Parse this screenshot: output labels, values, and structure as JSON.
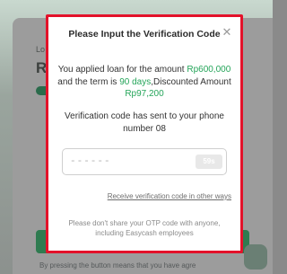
{
  "background": {
    "lo_text": "Lo",
    "r_text": "R",
    "footer_text": "By pressing the button means that you have agre"
  },
  "modal": {
    "title": "Please Input the Verification Code",
    "close_icon": "close-icon",
    "info": {
      "prefix": "You applied loan for the amount",
      "amount": "Rp600,000",
      "term_prefix": "and the term is",
      "term": "90 days",
      "discount_label": ",Discounted Amount",
      "discounted_amount": "Rp97,200"
    },
    "sent_message": "Verification code has sent to your phone number 08",
    "otp": {
      "placeholder": "------",
      "countdown": "59s"
    },
    "other_ways_link": "Receive verification code in other ways",
    "warning": "Please don't share your OTP code with anyone, including Easycash employees"
  },
  "colors": {
    "accent_green": "#25a55a",
    "highlight_border": "#e3122a"
  }
}
